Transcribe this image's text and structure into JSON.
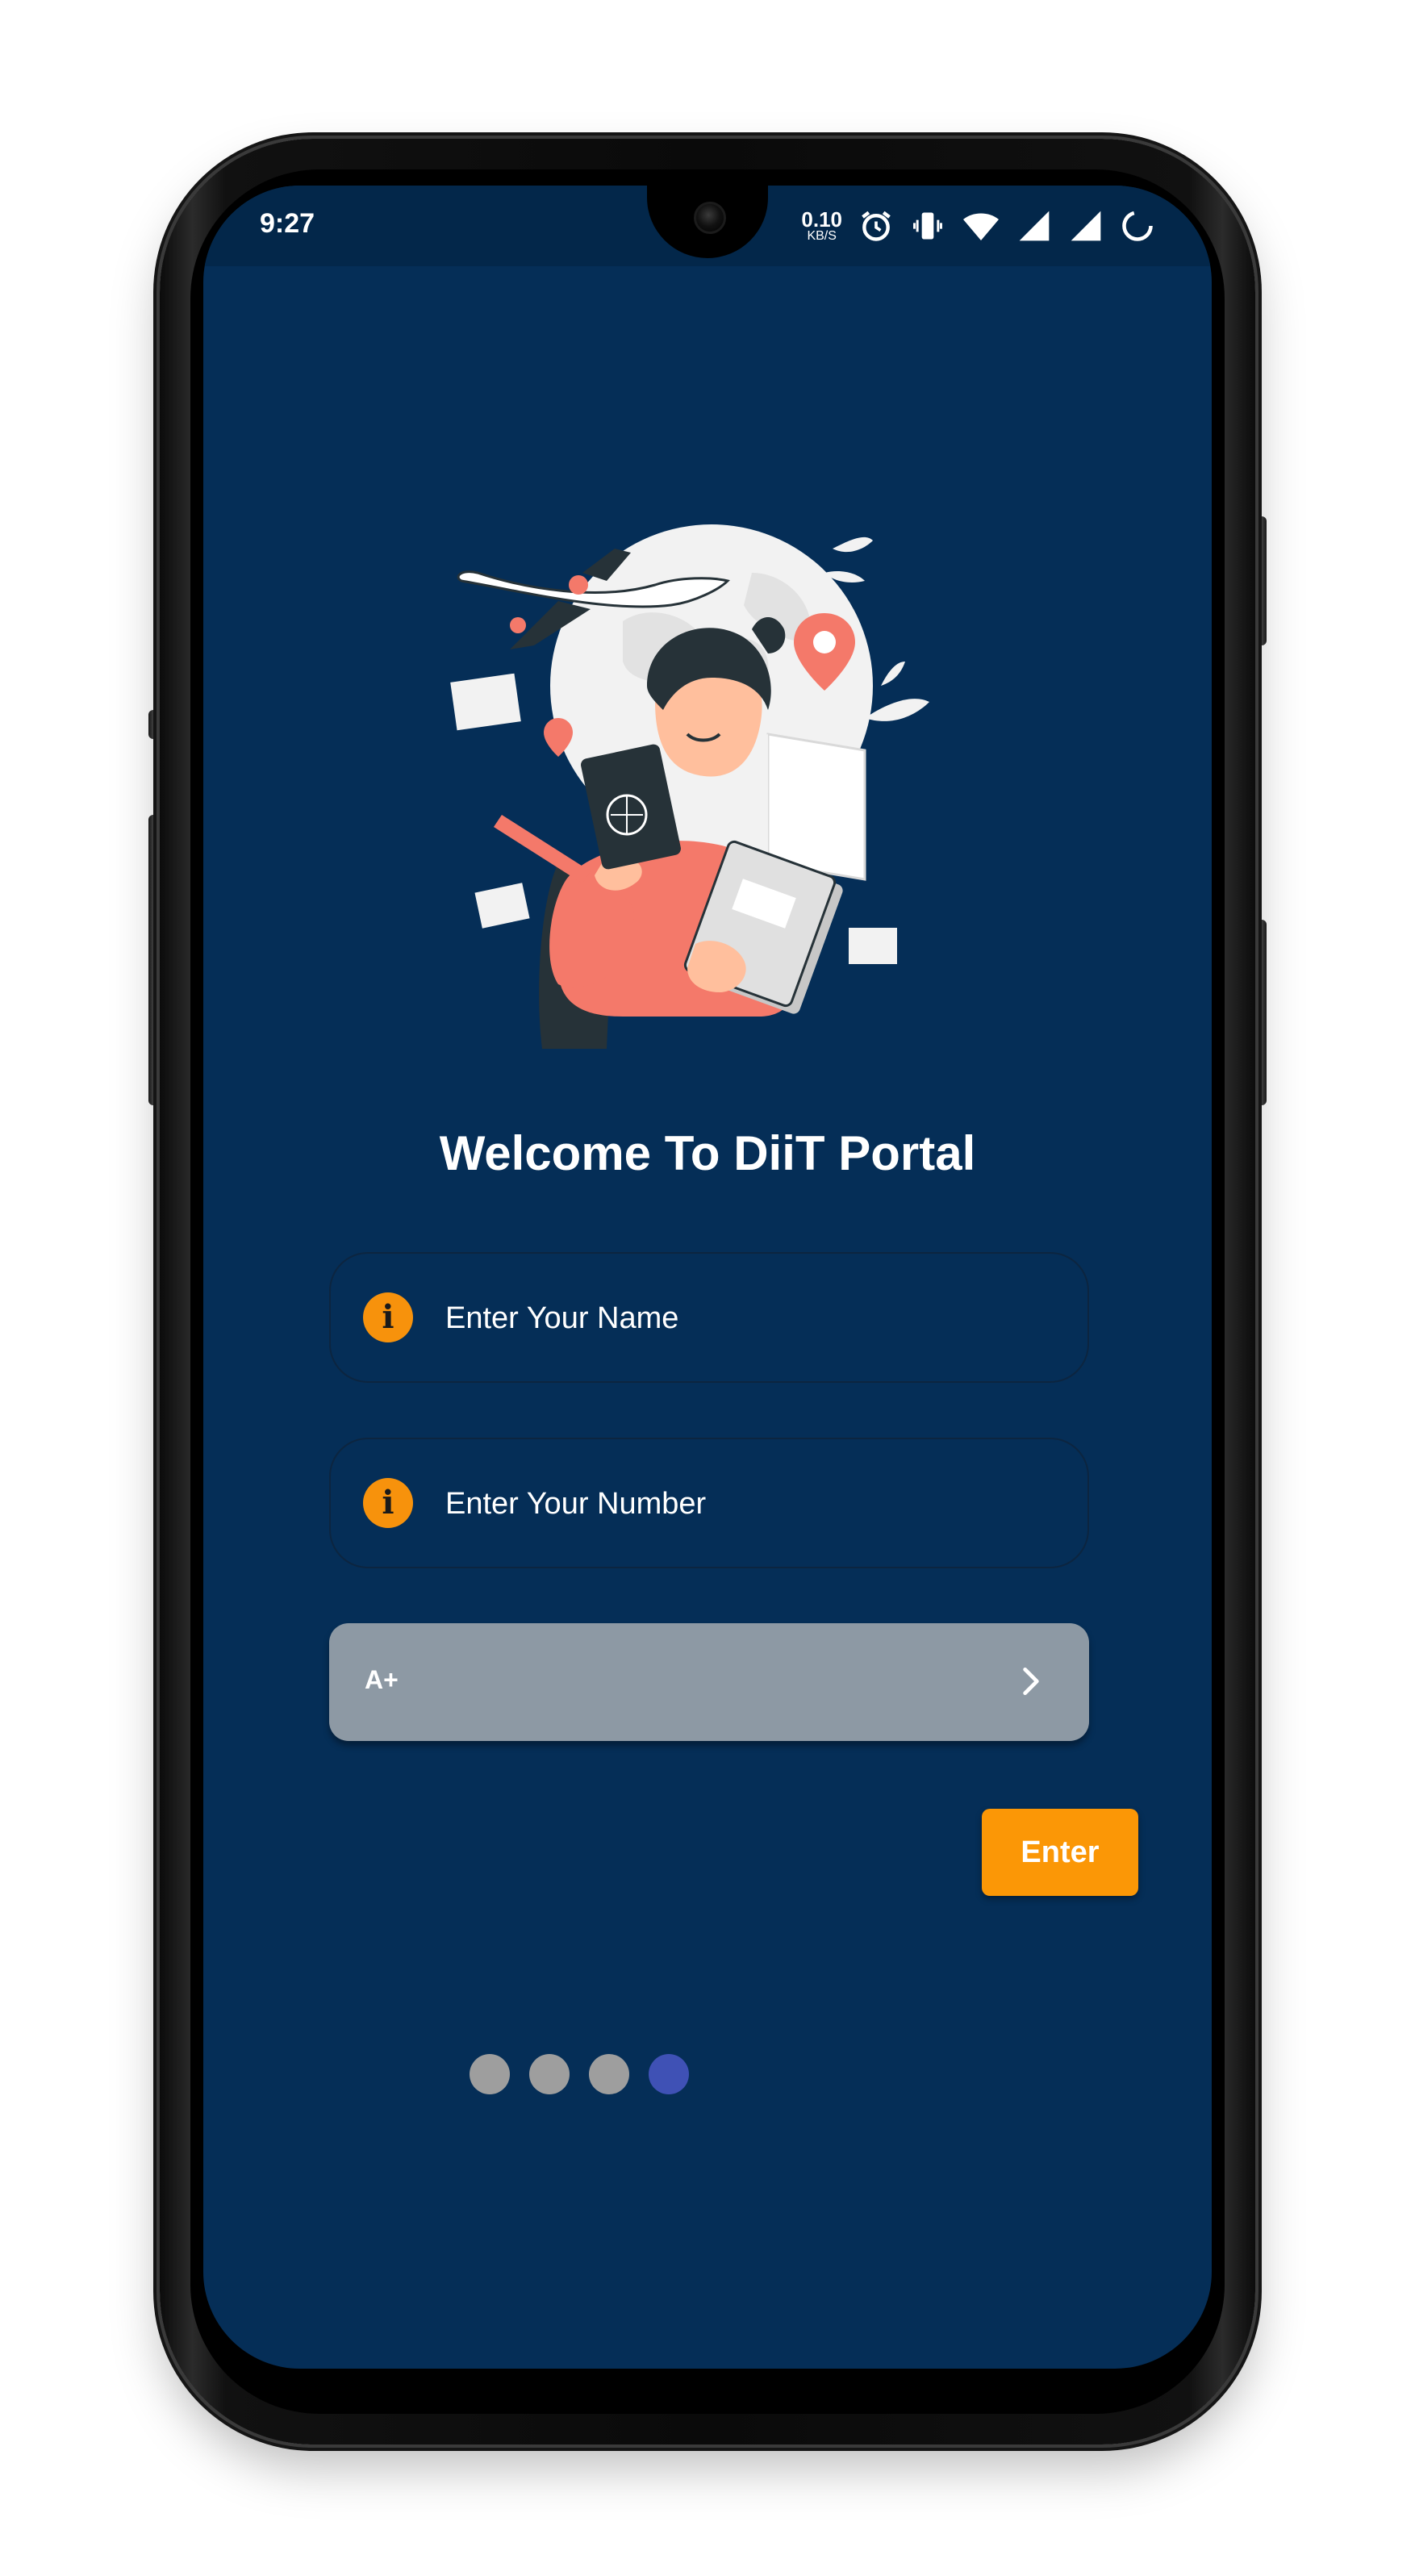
{
  "status_bar": {
    "time": "9:27",
    "net_speed_value": "0.10",
    "net_speed_unit": "KB/S",
    "icons": [
      "alarm-icon",
      "vibrate-icon",
      "wifi-icon",
      "cellular-signal-icon",
      "cellular-signal-icon",
      "battery-charging-icon"
    ]
  },
  "main": {
    "title": "Welcome To DiiT Portal",
    "name_field": {
      "placeholder": "Enter Your Name",
      "value": ""
    },
    "number_field": {
      "placeholder": "Enter Your Number",
      "value": ""
    },
    "grade_select": {
      "selected": "A+"
    },
    "enter_label": "Enter"
  },
  "pager": {
    "total": 4,
    "active_index": 3
  },
  "colors": {
    "background": "#052e57",
    "accent": "#fb9706",
    "info_icon": "#f7920c",
    "select_bg": "#8d99a4",
    "dot_inactive": "#9e9e9e",
    "dot_active": "#3f51b5"
  }
}
